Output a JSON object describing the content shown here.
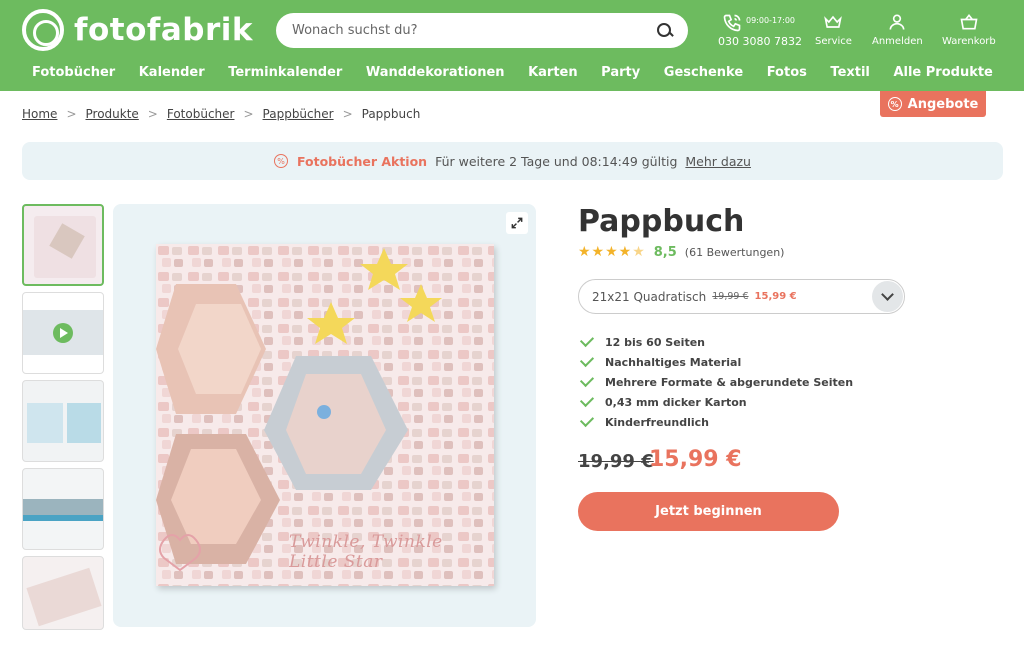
{
  "brand": {
    "name": "fotofabrik"
  },
  "search": {
    "placeholder": "Wonach suchst du?"
  },
  "header": {
    "phone_hours": "09:00-17:00",
    "phone_number": "030 3080 7832",
    "service_label": "Service",
    "login_label": "Anmelden",
    "cart_label": "Warenkorb"
  },
  "nav": {
    "items": [
      "Fotobücher",
      "Kalender",
      "Terminkalender",
      "Wanddekorationen",
      "Karten",
      "Party",
      "Geschenke",
      "Fotos",
      "Textil",
      "Alle Produkte"
    ]
  },
  "breadcrumb": {
    "items": [
      "Home",
      "Produkte",
      "Fotobücher",
      "Pappbücher"
    ],
    "current": "Pappbuch"
  },
  "offers_button": {
    "label": "Angebote"
  },
  "promo": {
    "title": "Fotobücher Aktion",
    "text": "Für weitere 2 Tage und 08:14:49 gültig",
    "link": "Mehr dazu"
  },
  "product": {
    "title": "Pappbuch",
    "rating_score": "8,5",
    "rating_count": "(61 Bewertungen)",
    "stars": 4.5,
    "variant": {
      "label": "21x21 Quadratisch",
      "old_price": "19,99 €",
      "new_price": "15,99 €"
    },
    "features": [
      "12 bis 60 Seiten",
      "Nachhaltiges Material",
      "Mehrere Formate & abgerundete Seiten",
      "0,43 mm dicker Karton",
      "Kinderfreundlich"
    ],
    "price_old": "19,99 €",
    "price_new": "15,99 €",
    "cta_label": "Jetzt beginnen",
    "cover_caption": "Twinkle, Twinkle Little Star"
  },
  "colors": {
    "brand_green": "#6dbb5f",
    "accent_orange": "#e9735e",
    "star_yellow": "#f3b32a"
  }
}
